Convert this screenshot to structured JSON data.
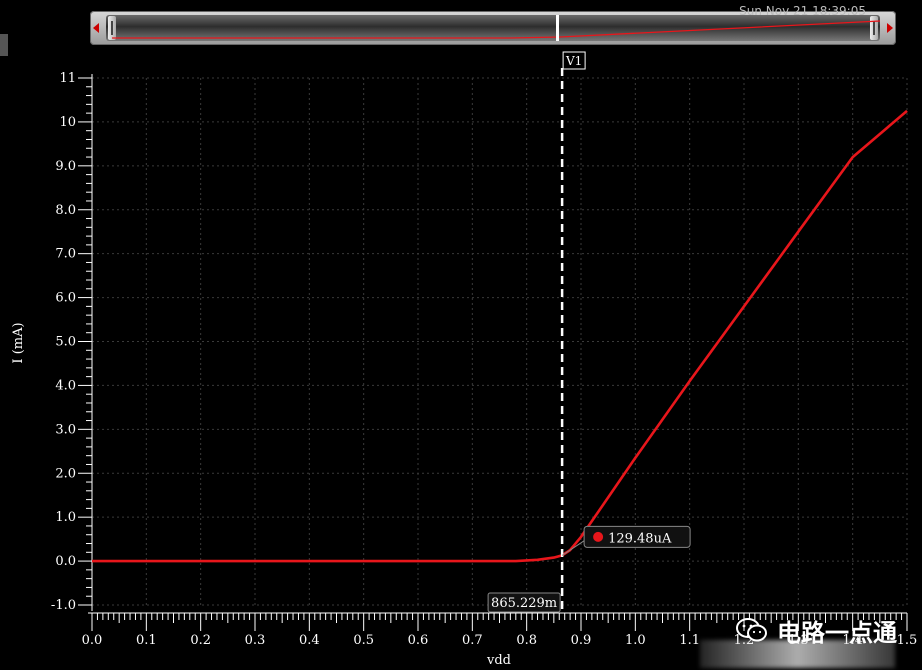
{
  "scroller": {
    "timestamp": "Sun Nov 21 18:39:05",
    "left_arrow_icon": "arrow-left-icon",
    "right_arrow_icon": "arrow-right-icon"
  },
  "colors": {
    "background": "#000000",
    "trace": "#e8161b",
    "cursor": "#ffffff",
    "axis_text": "#ffffff",
    "grid": "#3a3a3a"
  },
  "chart_data": {
    "type": "line",
    "xlabel": "vdd",
    "ylabel": "I (mA)",
    "xlim": [
      0.0,
      1.5
    ],
    "ylim": [
      -1.0,
      11.0
    ],
    "grid": true,
    "x_ticks": [
      "0.0",
      "0.1",
      "0.2",
      "0.3",
      "0.4",
      "0.5",
      "0.6",
      "0.7",
      "0.8",
      "0.9",
      "1.0",
      "1.1",
      "1.2",
      "1.3",
      "1.4",
      "1.5"
    ],
    "y_ticks": [
      "-1.0",
      "0.0",
      "1.0",
      "2.0",
      "3.0",
      "4.0",
      "5.0",
      "6.0",
      "7.0",
      "8.0",
      "9.0",
      "10",
      "11"
    ],
    "series": [
      {
        "x": [
          0.0,
          0.5,
          0.78,
          0.82,
          0.85,
          0.865,
          0.88,
          0.9,
          0.95,
          1.0,
          1.1,
          1.2,
          1.3,
          1.4,
          1.5
        ],
        "y": [
          0.0,
          0.0,
          0.0,
          0.03,
          0.08,
          0.13,
          0.25,
          0.55,
          1.45,
          2.35,
          4.1,
          5.8,
          7.5,
          9.2,
          10.25
        ]
      }
    ],
    "cursor": {
      "name": "V1",
      "x": 0.865229,
      "x_label": "865.229m",
      "y": 0.12948,
      "y_label": "129.48uA"
    }
  },
  "watermark": {
    "text": "电路一点通",
    "icon": "wechat-icon"
  }
}
